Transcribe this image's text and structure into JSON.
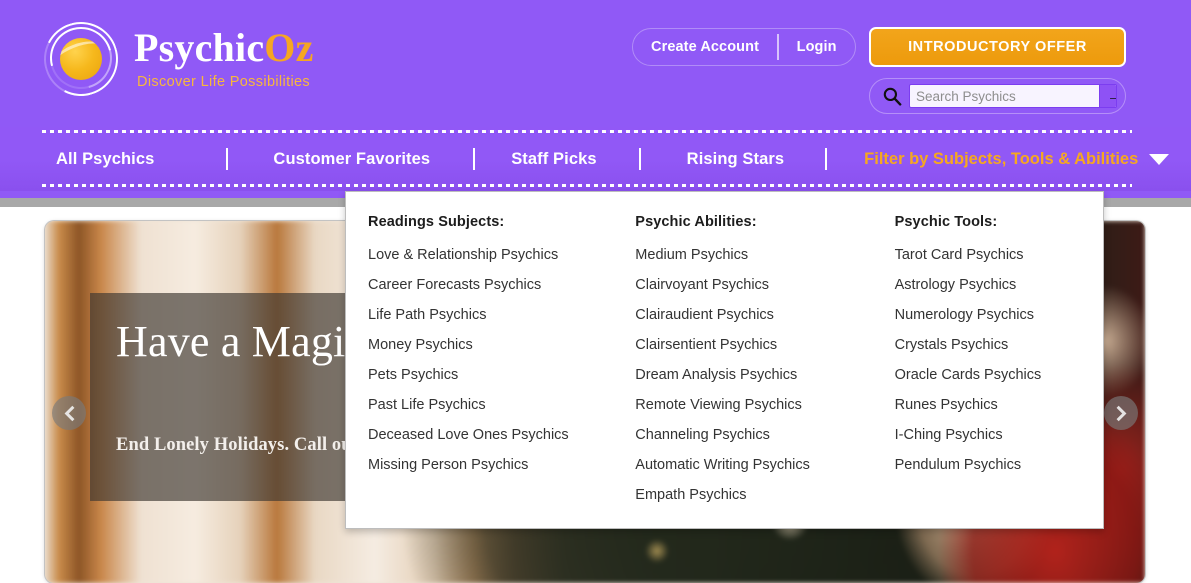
{
  "brand": {
    "name_primary": "Psychic",
    "name_accent": "Oz",
    "tagline": "Discover Life Possibilities",
    "logo_icon": "psychic-orb-logo"
  },
  "colors": {
    "header_purple": "#9059f6",
    "accent_orange": "#f5a623",
    "offer_orange": "#ef9d0f",
    "nav_filter_orange": "#f6a81f",
    "text_dark": "#333333",
    "page_seam_gray": "#a8a8a8"
  },
  "header": {
    "account": {
      "create_account_label": "Create Account",
      "login_label": "Login"
    },
    "offer_button_label": "INTRODUCTORY OFFER",
    "search": {
      "placeholder": "Search Psychics",
      "value": "",
      "icon": "search-icon",
      "submit_icon": "arrow-right-icon",
      "submit_glyph": "→"
    }
  },
  "nav": {
    "items": [
      {
        "label": "All Psychics"
      },
      {
        "label": "Customer Favorites"
      },
      {
        "label": "Staff Picks"
      },
      {
        "label": "Rising Stars"
      }
    ],
    "filter": {
      "label": "Filter by Subjects,  Tools & Abilities",
      "caret_icon": "chevron-down-icon",
      "expanded": true
    }
  },
  "mega_menu": {
    "columns": [
      {
        "heading": "Readings Subjects:",
        "items": [
          "Love & Relationship Psychics",
          "Career Forecasts Psychics",
          "Life Path Psychics",
          "Money Psychics",
          "Pets Psychics",
          "Past Life Psychics",
          "Deceased Love Ones Psychics",
          "Missing Person Psychics"
        ]
      },
      {
        "heading": "Psychic Abilities:",
        "items": [
          "Medium Psychics",
          "Clairvoyant Psychics",
          "Clairaudient Psychics",
          "Clairsentient Psychics",
          "Dream Analysis Psychics",
          "Remote Viewing Psychics",
          "Channeling Psychics",
          "Automatic Writing Psychics",
          "Empath Psychics"
        ]
      },
      {
        "heading": "Psychic Tools:",
        "items": [
          "Tarot Card Psychics",
          "Astrology Psychics",
          "Numerology Psychics",
          "Crystals Psychics",
          "Oracle Cards Psychics",
          "Runes Psychics",
          "I-Ching Psychics",
          "Pendulum Psychics"
        ]
      }
    ]
  },
  "hero": {
    "title": "Have a Magical Season!",
    "subtitle": "End Lonely Holidays. Call our Psychics Now!",
    "prev_icon": "chevron-left-icon",
    "next_icon": "chevron-right-icon"
  }
}
